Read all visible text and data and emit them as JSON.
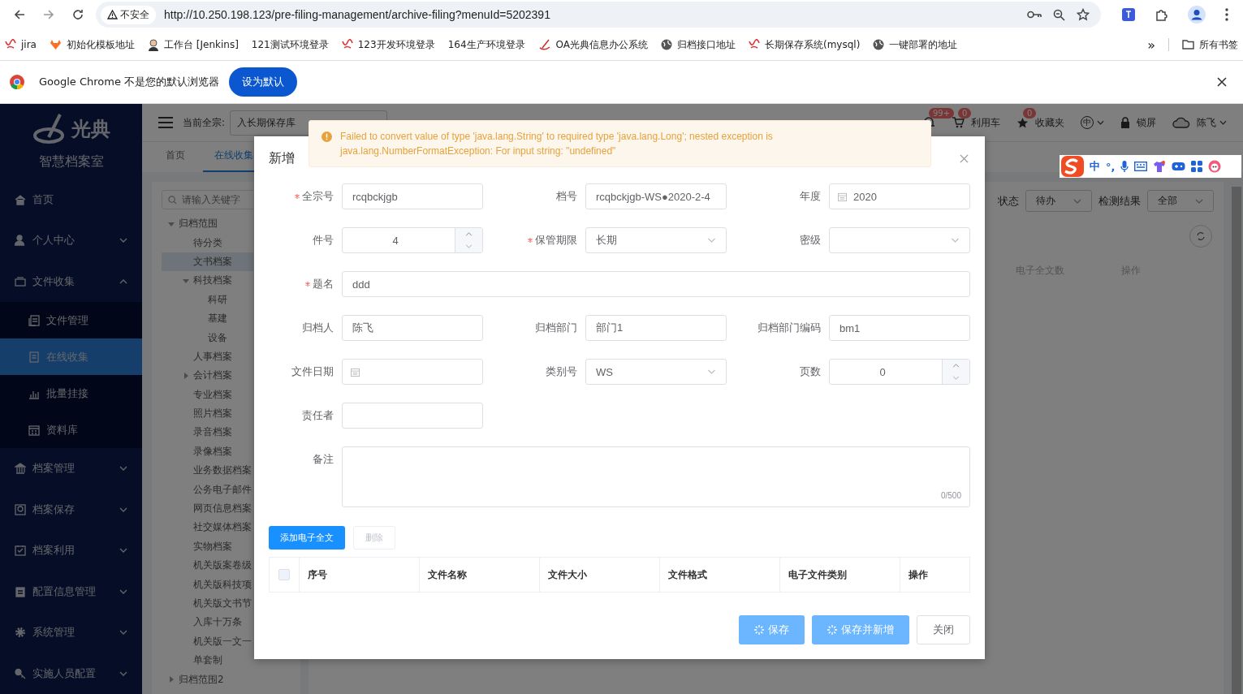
{
  "browser": {
    "security_label": "不安全",
    "url": "http://10.250.198.123/pre-filing-management/archive-filing?menuId=5202391",
    "bookmarks": [
      {
        "label": "jira",
        "kind": "swirl"
      },
      {
        "label": "初始化模板地址",
        "kind": "fox"
      },
      {
        "label": "工作台 [Jenkins]",
        "kind": "avatar"
      },
      {
        "label": "121测试环境登录",
        "kind": "none"
      },
      {
        "label": "123开发环境登录",
        "kind": "swirl"
      },
      {
        "label": "164生产环境登录",
        "kind": "none"
      },
      {
        "label": "OA光典信息办公系统",
        "kind": "pen"
      },
      {
        "label": "归档接口地址",
        "kind": "globe"
      },
      {
        "label": "长期保存系统(mysql)",
        "kind": "swirl"
      },
      {
        "label": "一键部署的地址",
        "kind": "globe"
      }
    ],
    "more": "»",
    "all_bookmarks": "所有书签"
  },
  "infobar": {
    "message": "Google Chrome 不是您的默认浏览器",
    "button": "设为默认"
  },
  "sidebar": {
    "logo_text": "光典",
    "subtitle": "智慧档案室",
    "items": [
      {
        "label": "首页",
        "selected": false
      },
      {
        "label": "个人中心",
        "selected": false,
        "expanded": false
      },
      {
        "label": "文件收集",
        "selected": false,
        "expanded": true,
        "children": [
          {
            "label": "文件管理",
            "selected": false
          },
          {
            "label": "在线收集",
            "selected": true
          },
          {
            "label": "批量挂接",
            "selected": false
          },
          {
            "label": "资料库",
            "selected": false
          }
        ]
      },
      {
        "label": "档案管理",
        "selected": false,
        "expanded": false
      },
      {
        "label": "档案保存",
        "selected": false,
        "expanded": false
      },
      {
        "label": "档案利用",
        "selected": false,
        "expanded": false
      },
      {
        "label": "配置信息管理",
        "selected": false,
        "expanded": false
      },
      {
        "label": "系统管理",
        "selected": false,
        "expanded": false
      },
      {
        "label": "实施人员配置",
        "selected": false,
        "expanded": false
      }
    ]
  },
  "header": {
    "fonds_label": "当前全宗:",
    "fonds_value": "入长期保存库",
    "notice_badge": "99+",
    "cart_count": "0",
    "cart_label": "利用车",
    "favorites_count": "0",
    "favorites_label": "收藏夹",
    "language": "中",
    "lock_label": "锁屏",
    "user_name": "陈飞"
  },
  "tabs": [
    {
      "label": "首页",
      "selected": false
    },
    {
      "label": "在线收集",
      "selected": true
    }
  ],
  "tree": {
    "placeholder": "请输入关键字",
    "nodes": [
      {
        "label": "归档范围",
        "selected": false,
        "expanded": true,
        "children": [
          {
            "label": "待分类",
            "selected": false
          },
          {
            "label": "文书档案",
            "selected": true
          },
          {
            "label": "科技档案",
            "selected": false,
            "expanded": true,
            "children": [
              {
                "label": "科研",
                "selected": false
              },
              {
                "label": "基建",
                "selected": false
              },
              {
                "label": "设备",
                "selected": false
              }
            ]
          },
          {
            "label": "人事档案",
            "selected": false
          },
          {
            "label": "会计档案",
            "selected": false,
            "expanded": false
          },
          {
            "label": "专业档案",
            "selected": false
          },
          {
            "label": "照片档案",
            "selected": false
          },
          {
            "label": "录音档案",
            "selected": false
          },
          {
            "label": "录像档案",
            "selected": false
          },
          {
            "label": "业务数据档案",
            "selected": false
          },
          {
            "label": "公务电子邮件",
            "selected": false
          },
          {
            "label": "网页信息档案",
            "selected": false
          },
          {
            "label": "社交媒体档案",
            "selected": false
          },
          {
            "label": "实物档案",
            "selected": false
          },
          {
            "label": "机关版案卷级",
            "selected": false
          },
          {
            "label": "机关版科技项",
            "selected": false
          },
          {
            "label": "机关版文书节",
            "selected": false
          },
          {
            "label": "入库十万条",
            "selected": false
          },
          {
            "label": "机关版一文一",
            "selected": false
          },
          {
            "label": "单套制",
            "selected": false
          }
        ]
      },
      {
        "label": "归档范围2",
        "selected": false,
        "expanded": false
      }
    ]
  },
  "filters": [
    {
      "label": "状态",
      "value": "待办"
    },
    {
      "label": "检测结果",
      "value": "全部"
    }
  ],
  "list_columns": [
    "电子全文数",
    "操作"
  ],
  "toast": {
    "kind": "warning",
    "message": "Failed to convert value of type 'java.lang.String' to required type 'java.lang.Long'; nested exception is java.lang.NumberFormatException: For input string: \"undefined\""
  },
  "ime": {
    "mode": "中",
    "punctuation": "°,"
  },
  "dialog": {
    "title": "新增",
    "fields": [
      {
        "label": "全宗号",
        "required": true,
        "kind": "text",
        "value": "rcqbckjgb"
      },
      {
        "label": "档号",
        "required": false,
        "kind": "text",
        "value": "rcqbckjgb-WS●2020-2-4"
      },
      {
        "label": "年度",
        "required": false,
        "kind": "date",
        "value": "2020"
      },
      {
        "label": "件号",
        "required": false,
        "kind": "number",
        "value": "4"
      },
      {
        "label": "保管期限",
        "required": true,
        "kind": "select",
        "value": "长期"
      },
      {
        "label": "密级",
        "required": false,
        "kind": "select"
      },
      {
        "label": "题名",
        "required": true,
        "kind": "wide",
        "value": "ddd"
      },
      {
        "label": "归档人",
        "required": false,
        "kind": "text",
        "value": "陈飞"
      },
      {
        "label": "归档部门",
        "required": false,
        "kind": "text",
        "value": "部门1"
      },
      {
        "label": "归档部门编码",
        "required": false,
        "kind": "text",
        "value": "bm1"
      },
      {
        "label": "文件日期",
        "required": false,
        "kind": "date"
      },
      {
        "label": "类别号",
        "required": false,
        "kind": "select",
        "value": "WS"
      },
      {
        "label": "页数",
        "required": false,
        "kind": "number",
        "value": "0"
      },
      {
        "label": "责任者",
        "required": false,
        "kind": "text"
      },
      {
        "label": "备注",
        "required": false,
        "kind": "textarea",
        "counter": "0/500"
      }
    ],
    "attachment_buttons": [
      {
        "label": "添加电子全文",
        "kind": "primary",
        "disabled": false
      },
      {
        "label": "删除",
        "kind": "default",
        "disabled": true
      }
    ],
    "table": {
      "select_all": false,
      "columns": [
        "序号",
        "文件名称",
        "文件大小",
        "文件格式",
        "电子文件类别",
        "操作"
      ]
    },
    "footer_buttons": [
      {
        "label": "保存",
        "kind": "primary",
        "loading": true
      },
      {
        "label": "保存并新增",
        "kind": "primary",
        "loading": true
      },
      {
        "label": "关闭",
        "kind": "default",
        "loading": false
      }
    ]
  }
}
